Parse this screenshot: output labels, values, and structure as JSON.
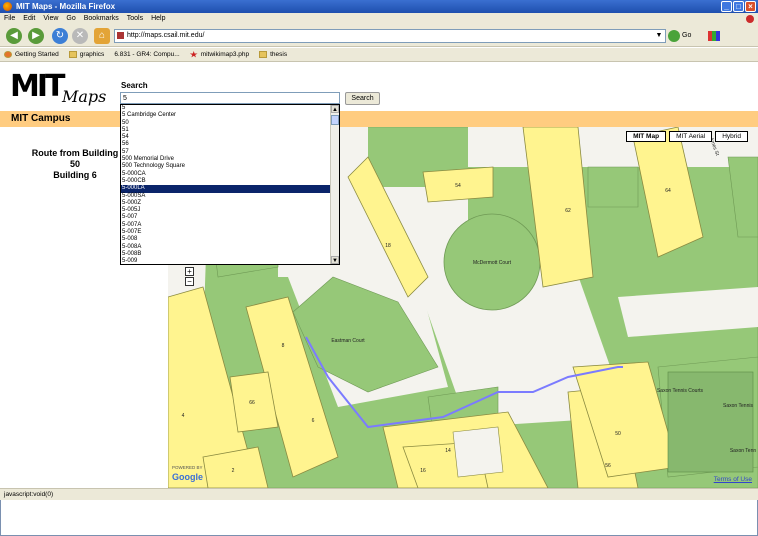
{
  "window": {
    "title": "MIT Maps - Mozilla Firefox"
  },
  "menu": [
    "File",
    "Edit",
    "View",
    "Go",
    "Bookmarks",
    "Tools",
    "Help"
  ],
  "navbar": {
    "url": "http://maps.csail.mit.edu/",
    "go_label": "Go"
  },
  "bookmarks": [
    {
      "label": "Getting Started",
      "icon": "getting-started-icon"
    },
    {
      "label": "graphics",
      "icon": "folder-icon"
    },
    {
      "label": "6.831 - GR4: Compu...",
      "icon": "page-icon"
    },
    {
      "label": "mitwikimap3.php",
      "icon": "star-icon"
    },
    {
      "label": "thesis",
      "icon": "folder-icon"
    }
  ],
  "logo": {
    "mit": "MIT",
    "maps": "Maps"
  },
  "search": {
    "label": "Search",
    "value": "5",
    "button": "Search"
  },
  "campus_title": "MIT Campus",
  "route": {
    "line1": "Route from Building 50",
    "line2": "Building 6"
  },
  "suggestions": [
    "5",
    "5 Cambridge Center",
    "50",
    "51",
    "54",
    "56",
    "57",
    "500 Memorial Drive",
    "500 Technology Square",
    "5-000CA",
    "5-000CB",
    "5-000LA",
    "5-000SA",
    "5-000Z",
    "5-005J",
    "5-007",
    "5-007A",
    "5-007E",
    "5-008",
    "5-008A",
    "5-008B",
    "5-009"
  ],
  "selected_suggestion": "5-000LA",
  "map": {
    "types": [
      "MIT Map",
      "MIT Aerial",
      "Hybrid"
    ],
    "active_type": "MIT Map",
    "zoom_in": "+",
    "zoom_out": "−",
    "labels": {
      "mcdermott": "McDermott Court",
      "eastman": "Eastman Court",
      "saxon_courts": "Saxon Tennis Courts",
      "saxon_tennis": "Saxon Tennis",
      "saxon_ten": "Saxon Tenn"
    },
    "building_numbers": [
      "54",
      "18",
      "62",
      "64",
      "4",
      "8",
      "66",
      "6",
      "50",
      "14",
      "16",
      "56",
      "2"
    ],
    "street": "Ames St",
    "powered_by": "POWERED BY",
    "google": "Google",
    "terms": "Terms of Use"
  },
  "colors": {
    "building": "#fff48f",
    "green": "#96c878",
    "route": "#7b7bff",
    "campus_bar": "#ffcc80",
    "selection": "#0a246a"
  },
  "status": "javascript:void(0)"
}
